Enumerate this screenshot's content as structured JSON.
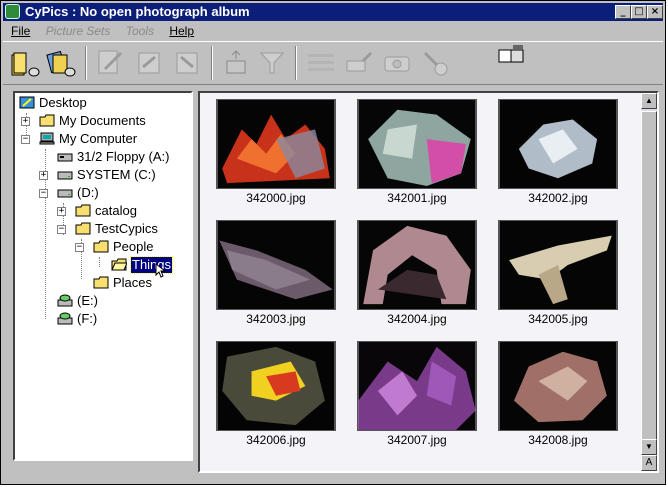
{
  "window": {
    "title": "CyPics : No open photograph album"
  },
  "title_buttons": {
    "minimize": "_",
    "maximize": "□",
    "close": "×"
  },
  "menu": [
    {
      "label": "File",
      "enabled": true
    },
    {
      "label": "Picture Sets",
      "enabled": false
    },
    {
      "label": "Tools",
      "enabled": false
    },
    {
      "label": "Help",
      "enabled": true
    }
  ],
  "toolbar": {
    "icons": [
      "open-album-icon",
      "new-album-icon",
      "edit-icon",
      "export-icon",
      "import-icon",
      "sort-icon",
      "filter-icon",
      "text-icon",
      "paint-icon",
      "camera-icon",
      "settings-icon",
      "book-icon"
    ]
  },
  "tree": [
    {
      "label": "Desktop",
      "icon": "desktop-icon"
    },
    {
      "label": "My Documents",
      "icon": "folder-icon"
    },
    {
      "label": "My Computer",
      "icon": "computer-icon"
    },
    {
      "label": "31/2 Floppy (A:)",
      "icon": "floppy-icon"
    },
    {
      "label": "SYSTEM (C:)",
      "icon": "drive-icon"
    },
    {
      "label": "(D:)",
      "icon": "drive-icon"
    },
    {
      "label": "catalog",
      "icon": "folder-icon"
    },
    {
      "label": "TestCypics",
      "icon": "folder-icon"
    },
    {
      "label": "People",
      "icon": "folder-icon"
    },
    {
      "label": "Things",
      "icon": "open-folder-icon",
      "selected": true
    },
    {
      "label": "Places",
      "icon": "folder-icon"
    },
    {
      "label": "(E:)",
      "icon": "cdrom-icon"
    },
    {
      "label": "(F:)",
      "icon": "cdrom-icon"
    }
  ],
  "thumbnails": [
    {
      "file": "342000.jpg"
    },
    {
      "file": "342001.jpg"
    },
    {
      "file": "342002.jpg"
    },
    {
      "file": "342003.jpg"
    },
    {
      "file": "342004.jpg"
    },
    {
      "file": "342005.jpg"
    },
    {
      "file": "342006.jpg"
    },
    {
      "file": "342007.jpg"
    },
    {
      "file": "342008.jpg"
    }
  ],
  "colors": {
    "title_bar": "#0a1e7a",
    "selection": "#000080",
    "face": "#c0c0c0"
  }
}
